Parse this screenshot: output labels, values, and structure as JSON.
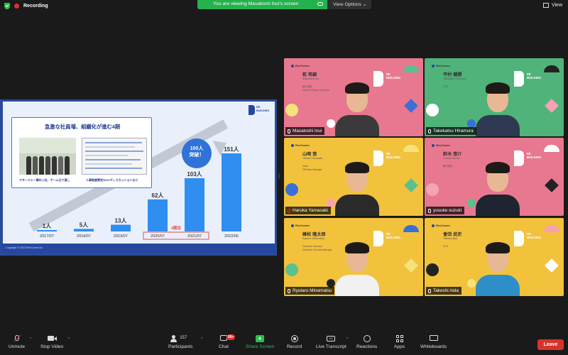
{
  "topbar": {
    "recording_label": "Recording",
    "viewing_banner": "You are viewing Masatoshi Inui's screen",
    "view_options_label": "View Options ⌄",
    "view_label": "View"
  },
  "slide": {
    "callout_title": "急激な社員増、組織化が進む4期",
    "caption_left": "マネージャー陣の入社、チーム立て直し",
    "caption_right": "人事制度策定/MVVディスカッションなど",
    "badge_line1": "100人",
    "badge_line2": "突破！",
    "period_label": "4期目",
    "logo_line1": "RE",
    "logo_line2": "BUILDING",
    "footer": "Copyright © 2022 RevComm Inc."
  },
  "chart_data": {
    "type": "bar",
    "categories": [
      "2017/07",
      "2018/07",
      "2019/07",
      "2020/07",
      "2021/07",
      "2022/06"
    ],
    "values": [
      1,
      5,
      13,
      62,
      103,
      151
    ],
    "value_labels": [
      "1人",
      "5人",
      "13人",
      "62人",
      "103人",
      "151人"
    ],
    "highlighted_categories": [
      "2020/07",
      "2021/07"
    ],
    "colors": {
      "bar": "#2f8ef0",
      "highlight_box": "#e05050",
      "label": "#1f3c8c"
    },
    "ylim": [
      0,
      151
    ]
  },
  "participants": [
    {
      "display_name": "Masatoshi Inui",
      "jp_name": "乾 将嗣",
      "romaji": "Masatoshi Inui",
      "role": "執行役員\nHead of Human Resource",
      "bg": "#e8788f",
      "body_color": "#3a3a3a",
      "active": true,
      "muted": false
    },
    {
      "display_name": "Takekatsu Hiramura",
      "jp_name": "平村 健勝",
      "romaji": "Takekatsu Hiramura",
      "role": "CTO",
      "bg": "#4fb37a",
      "body_color": "#2d3a52",
      "active": false,
      "muted": false
    },
    {
      "display_name": "Haruka Yamasaki",
      "jp_name": "山﨑 悠",
      "romaji": "Haruka Yamasaki",
      "role": "Sales\nOB Team Manager",
      "bg": "#f2c23c",
      "body_color": "#2a2a2a",
      "active": false,
      "muted": true
    },
    {
      "display_name": "yusuke suzuki",
      "jp_name": "鈴木 悠介",
      "romaji": "Yusuke Suzuki",
      "role": "執行役員",
      "bg": "#e8788f",
      "body_color": "#1e2430",
      "active": false,
      "muted": false
    },
    {
      "display_name": "Ryutaro Minematsu",
      "jp_name": "峰松 隆太郎",
      "romaji": "Ryutaro Minematsu",
      "role": "Customer Success\nCustomer Success Manager",
      "bg": "#f2c23c",
      "body_color": "#f1f1f1",
      "active": false,
      "muted": false
    },
    {
      "display_name": "Takeshi Aida",
      "jp_name": "會田 武史",
      "romaji": "Takeshi Aida",
      "role": "CEO",
      "bg": "#f2c23c",
      "body_color": "#2e8ec7",
      "active": false,
      "muted": false
    }
  ],
  "tile_brand": {
    "company": "RevComm",
    "logo_line1": "RE",
    "logo_line2": "BUILDING"
  },
  "toolbar": {
    "unmute": "Unmute",
    "stop_video": "Stop Video",
    "participants": "Participants",
    "participants_count": "157",
    "chat": "Chat",
    "chat_badge": "99+",
    "share_screen": "Share Screen",
    "record": "Record",
    "live_transcript": "Live Transcript",
    "reactions": "Reactions",
    "apps": "Apps",
    "whiteboards": "Whiteboards",
    "leave": "Leave"
  }
}
